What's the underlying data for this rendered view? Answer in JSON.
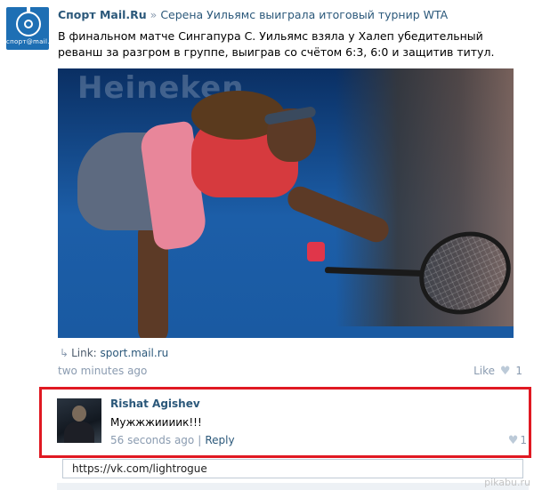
{
  "post": {
    "source_name": "Спорт Mail.Ru",
    "separator": "»",
    "headline": "Серена Уильямс выиграла итоговый турнир WTA",
    "body": "В финальном матче Сингапура С. Уильямс взяла у Халеп убедительный реванш за разгром в группе, выиграв со счётом 6:3, 6:0 и защитив титул.",
    "avatar_brand": "спорт@mail.ru",
    "photo_banner_text": "Heineken",
    "link_label": "Link:",
    "link_url": "sport.mail.ru",
    "time": "two minutes ago",
    "like_label": "Like",
    "like_count": "1"
  },
  "comment": {
    "author": "Rishat Agishev",
    "text": "Мужжжиииик!!!",
    "time": "56 seconds ago",
    "divider": "|",
    "reply_label": "Reply",
    "like_count": "1"
  },
  "reply_input": {
    "value": "https://vk.com/lightrogue"
  },
  "watermark": "pikabu.ru",
  "colors": {
    "link": "#2b587a",
    "muted": "#8a9bb0",
    "highlight_border": "#e01922"
  },
  "icons": {
    "link_arrow": "↳",
    "heart": "♥"
  }
}
